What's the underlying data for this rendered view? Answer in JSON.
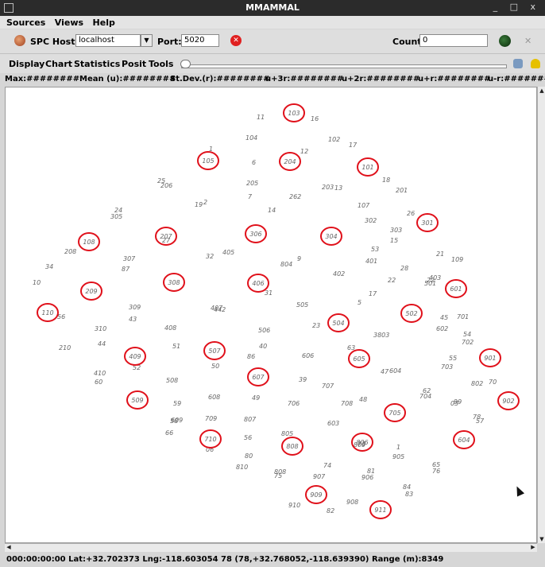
{
  "window": {
    "title": "MMAMMAL",
    "controls": "_ □ x"
  },
  "menu": {
    "items": [
      "Sources",
      "Views",
      "Help"
    ]
  },
  "host": {
    "label": "SPC Host:",
    "value": "localhost",
    "port_label": "Port:",
    "port_value": "5020",
    "count_label": "Count:",
    "count_value": "0"
  },
  "toolbar": {
    "items": [
      "Display",
      "Chart",
      "Statistics",
      "Posit",
      "Tools"
    ]
  },
  "stats": {
    "max": "Max:########",
    "mean": "Mean (u):########",
    "stdev": "St.Dev.(r):########",
    "u3r": "u+3r:########",
    "u2r": "u+2r:########",
    "ur": "u+r:########",
    "umr": "u-r:########"
  },
  "status": {
    "text": "000:00:00:00  Lat:+32.702373  Lng:-118.603054  78 (78,+32.768052,-118.639390)  Range (m):8349"
  },
  "colors": {
    "circle": "#e0101a",
    "label": "#666666",
    "titlebar": "#2b2b2b"
  },
  "plot": {
    "circled": [
      "103",
      "105",
      "204",
      "101",
      "301",
      "108",
      "207",
      "306",
      "304",
      "209",
      "308",
      "406",
      "110",
      "502",
      "504",
      "601",
      "409",
      "507",
      "605",
      "607",
      "901",
      "509",
      "902",
      "705",
      "710",
      "808",
      "806",
      "604",
      "909",
      "911"
    ],
    "labels": [
      "11",
      "16",
      "104",
      "102",
      "17",
      "1",
      "12",
      "6",
      "18",
      "205",
      "203",
      "13",
      "201",
      "25",
      "206",
      "2",
      "7",
      "262",
      "107",
      "24",
      "19",
      "26",
      "305",
      "14",
      "302",
      "303",
      "53",
      "15",
      "27",
      "208",
      "307",
      "32",
      "405",
      "9",
      "401",
      "21",
      "109",
      "34",
      "87",
      "804",
      "402",
      "28",
      "10",
      "22",
      "501",
      "31",
      "403",
      "17",
      "309",
      "56",
      "43",
      "407",
      "442",
      "505",
      "5",
      "22",
      "45",
      "701",
      "23",
      "602",
      "310",
      "408",
      "506",
      "3803",
      "54",
      "44",
      "51",
      "40",
      "63",
      "702",
      "210",
      "606",
      "86",
      "55",
      "703",
      "52",
      "50",
      "410",
      "39",
      "707",
      "47",
      "604",
      "60",
      "508",
      "802",
      "70",
      "62",
      "704",
      "59",
      "608",
      "49",
      "706",
      "708",
      "48",
      "03",
      "99",
      "609",
      "58",
      "709",
      "807",
      "603",
      "78",
      "57",
      "66",
      "56",
      "06",
      "805",
      "73",
      "809",
      "1",
      "905",
      "80",
      "65",
      "76",
      "810",
      "808",
      "75",
      "74",
      "907",
      "906",
      "81",
      "84",
      "83",
      "910",
      "82",
      "908"
    ]
  }
}
